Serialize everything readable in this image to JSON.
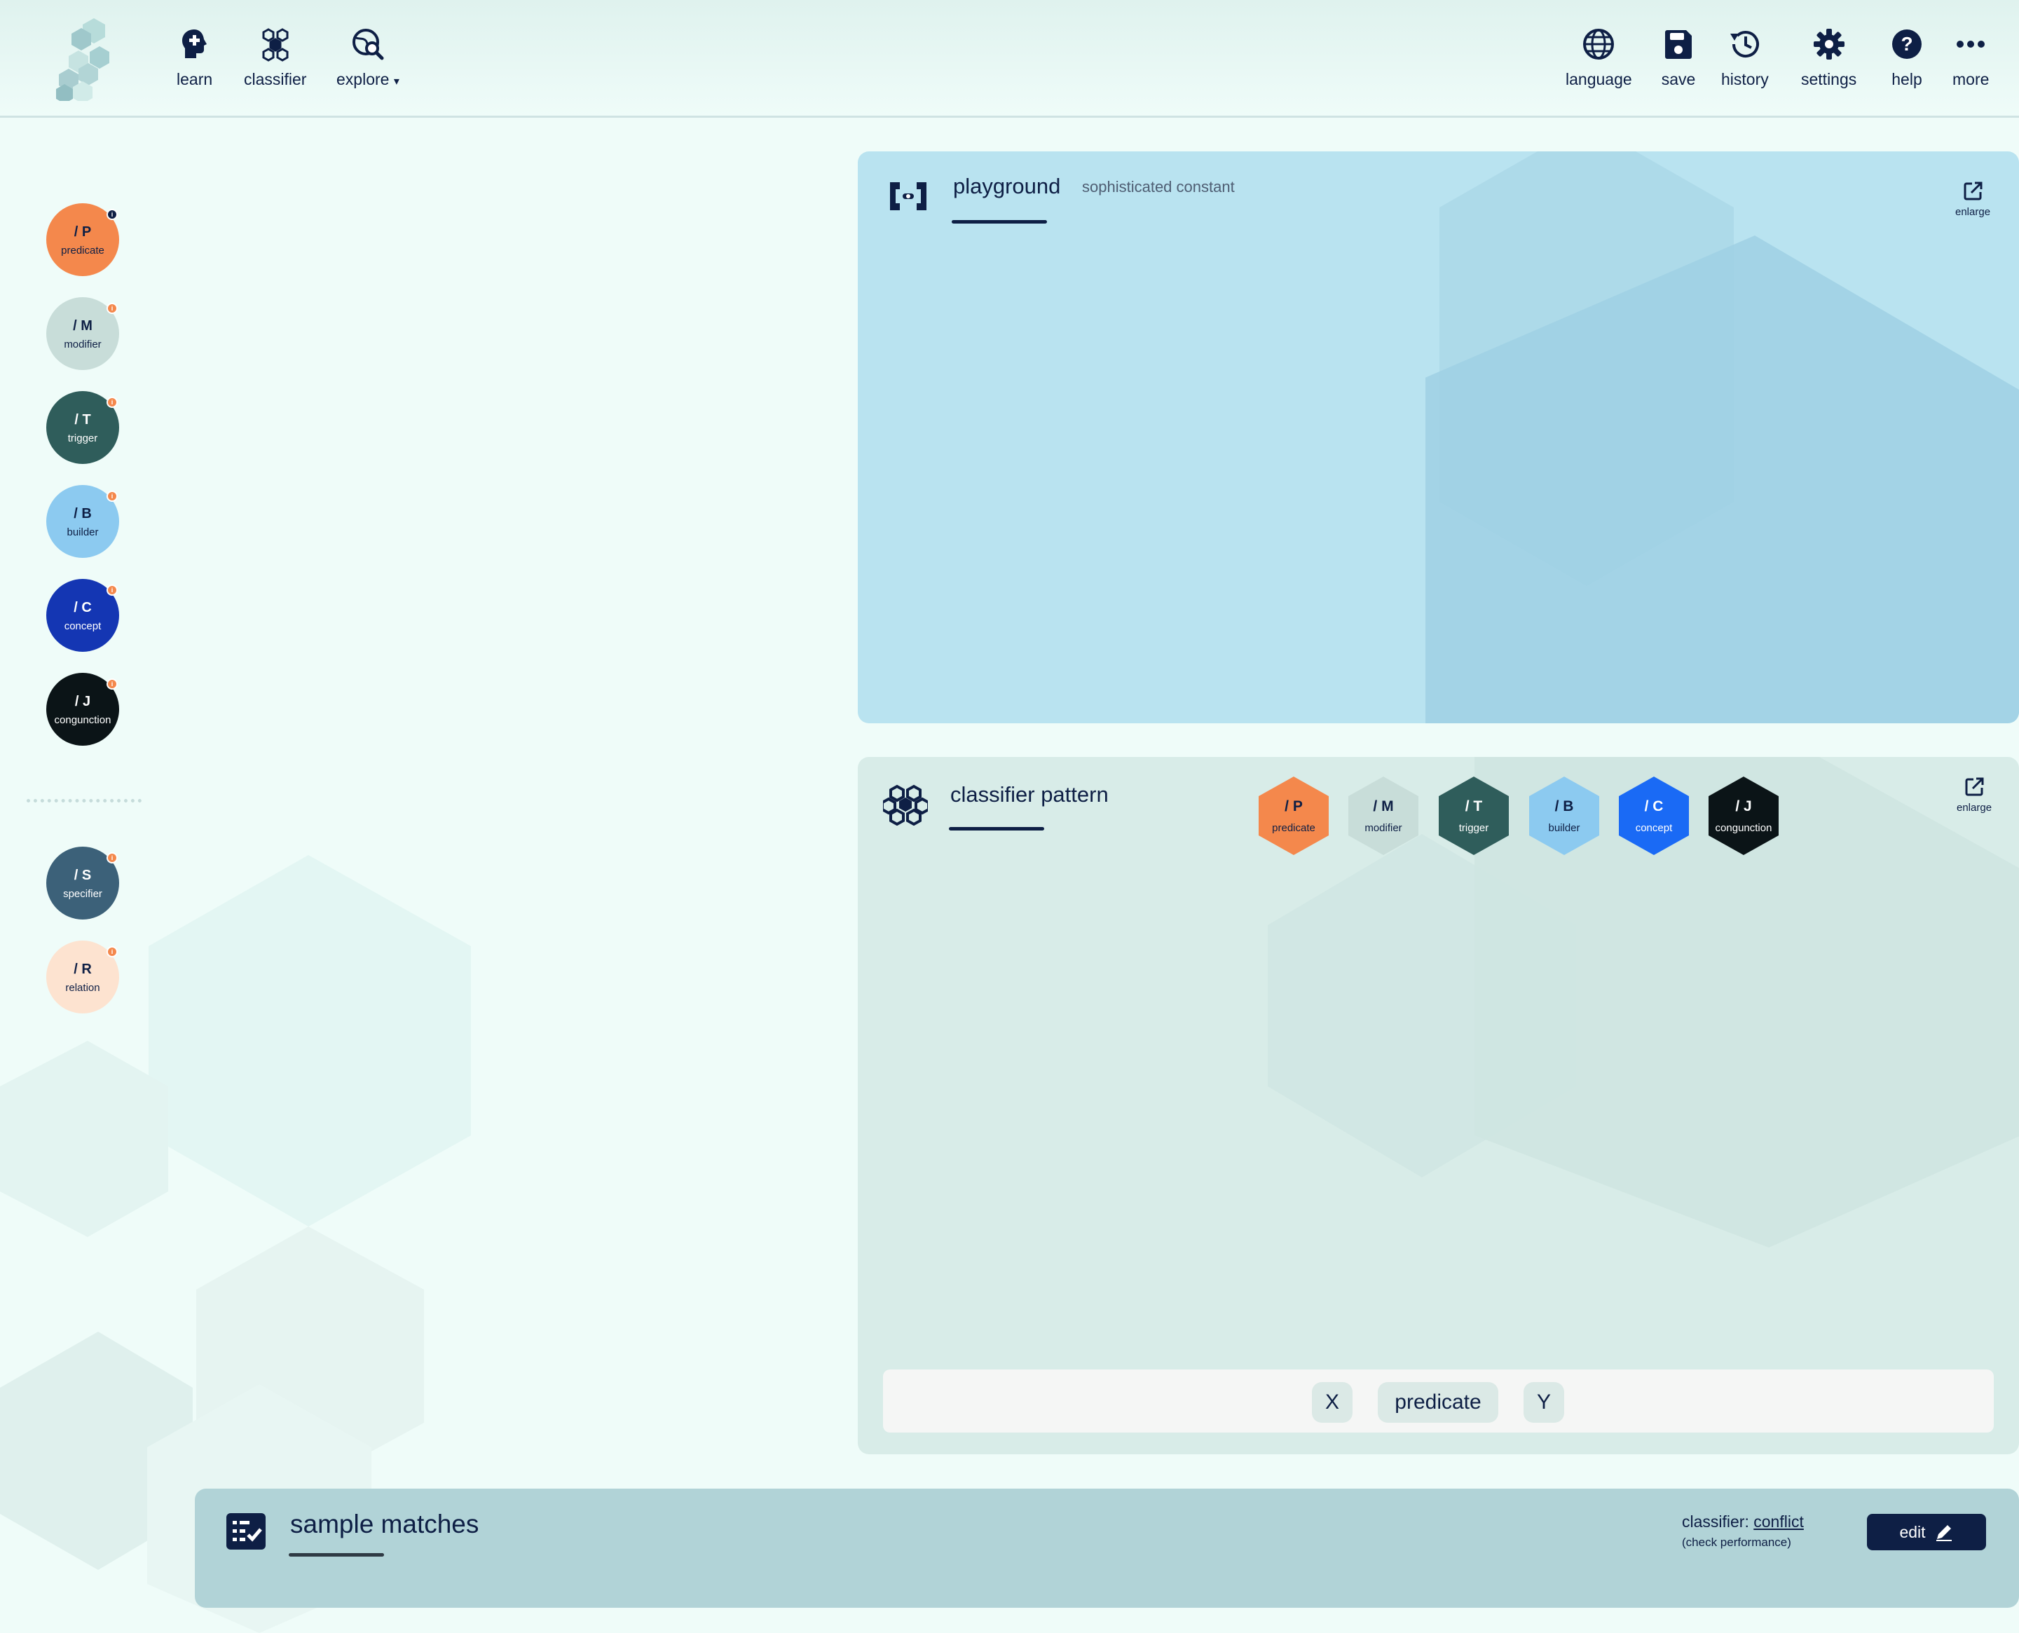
{
  "nav": [
    {
      "label": "learn",
      "icon": "head-plus-icon"
    },
    {
      "label": "classifier",
      "icon": "hexagon-cluster-icon"
    },
    {
      "label": "explore",
      "icon": "globe-search-icon",
      "dropdown": "▾"
    }
  ],
  "toolbar": [
    {
      "label": "language",
      "icon": "globe-icon"
    },
    {
      "label": "save",
      "icon": "floppy-disk-icon"
    },
    {
      "label": "history",
      "icon": "history-clock-icon"
    },
    {
      "label": "settings",
      "icon": "gear-icon"
    },
    {
      "label": "help",
      "icon": "question-icon"
    },
    {
      "label": "more",
      "icon": "ellipsis-icon"
    }
  ],
  "sidebar": {
    "items": [
      {
        "code": "/ P",
        "name": "predicate",
        "color": "#f4884c"
      },
      {
        "code": "/ M",
        "name": "modifier",
        "color": "#c8ddd9"
      },
      {
        "code": "/ T",
        "name": "trigger",
        "color": "#2f5d5b"
      },
      {
        "code": "/ B",
        "name": "builder",
        "color": "#8ccaf0"
      },
      {
        "code": "/ C",
        "name": "concept",
        "color": "#1436b3"
      },
      {
        "code": "/ J",
        "name": "conjunction",
        "color": "#0b1417"
      },
      {
        "code": "/ S",
        "name": "specifier",
        "color": "#3c6179"
      },
      {
        "code": "/ R",
        "name": "relation",
        "color": "#fde3d0"
      }
    ],
    "items_display": [
      "predicate",
      "modifier",
      "trigger",
      "builder",
      "concept",
      "congunction",
      "specifier",
      "relation"
    ],
    "info_mark": "i"
  },
  "playground": {
    "title": "playground",
    "subtitle": "sophisticated constant",
    "enlarge_label": "enlarge"
  },
  "classifier_pattern": {
    "title": "classifier pattern",
    "enlarge_label": "enlarge",
    "chips": [
      {
        "code": "/ P",
        "name": "predicate",
        "color": "#f4884c"
      },
      {
        "code": "/ M",
        "name": "modifier",
        "color": "#c8ddd9"
      },
      {
        "code": "/ T",
        "name": "trigger",
        "color": "#2f5d5b"
      },
      {
        "code": "/ B",
        "name": "builder",
        "color": "#8ccaf0"
      },
      {
        "code": "/ C",
        "name": "concept",
        "color": "#1a6af5"
      },
      {
        "code": "/ J",
        "name": "congunction",
        "color": "#0b1417"
      }
    ],
    "tokens": [
      "X",
      "predicate",
      "Y"
    ]
  },
  "sample_matches": {
    "title": "sample matches",
    "classifier_prefix": "classifier: ",
    "classifier_link": "conflict",
    "check_performance": "(check performance)",
    "edit_label": "edit"
  }
}
